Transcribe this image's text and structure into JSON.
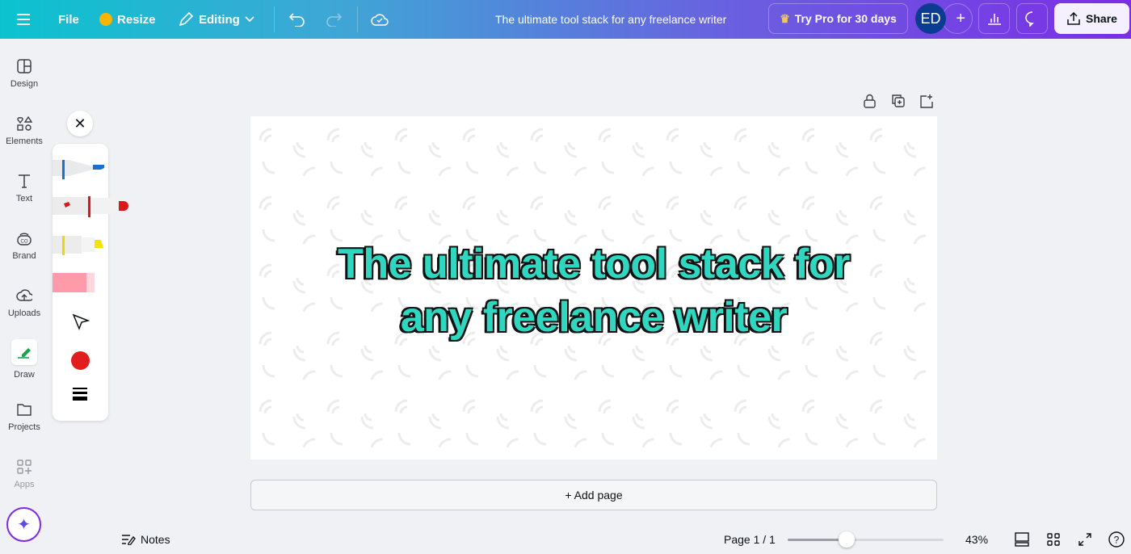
{
  "topbar": {
    "menu_icon": "hamburger-icon",
    "file": "File",
    "resize": "Resize",
    "editing": "Editing",
    "doc_title": "The ultimate tool stack for any freelance writer",
    "try_pro": "Try Pro for 30 days",
    "avatar": "ED",
    "share": "Share"
  },
  "sidebar": {
    "items": [
      {
        "label": "Design",
        "icon": "layout-icon"
      },
      {
        "label": "Elements",
        "icon": "shapes-icon"
      },
      {
        "label": "Text",
        "icon": "text-icon"
      },
      {
        "label": "Brand",
        "icon": "brand-icon"
      },
      {
        "label": "Uploads",
        "icon": "cloud-upload-icon"
      },
      {
        "label": "Draw",
        "icon": "draw-icon"
      },
      {
        "label": "Projects",
        "icon": "folder-icon"
      },
      {
        "label": "Apps",
        "icon": "apps-icon"
      }
    ]
  },
  "draw_panel": {
    "tools": [
      "pen",
      "marker",
      "highlighter",
      "eraser",
      "select"
    ],
    "color": "#e21d1d"
  },
  "canvas": {
    "line1": "The ultimate tool stack for",
    "line2": "any freelance writer",
    "text_color": "#2fd6c0"
  },
  "add_page": "+ Add page",
  "bottom": {
    "notes": "Notes",
    "page": "Page 1 / 1",
    "zoom": "43%",
    "zoom_value": 43
  }
}
